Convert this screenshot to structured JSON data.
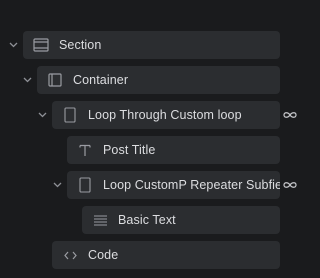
{
  "tree": {
    "section": {
      "label": "Section",
      "icon": "section-icon"
    },
    "container": {
      "label": "Container",
      "icon": "container-icon"
    },
    "loop1": {
      "label": "Loop Through Custom loop",
      "icon": "loop-item-icon",
      "link_icon": "infinity-icon"
    },
    "post_title": {
      "label": "Post Title",
      "icon": "text-icon"
    },
    "loop2": {
      "label": "Loop CustomP Repeater Subfiel",
      "icon": "loop-item-icon",
      "link_icon": "infinity-icon"
    },
    "basic_text": {
      "label": "Basic Text",
      "icon": "text-lines-icon"
    },
    "code": {
      "label": "Code",
      "icon": "code-icon"
    }
  },
  "colors": {
    "background": "#1a1b1d",
    "card": "#2b2d30",
    "text": "#dcdde0",
    "icon": "#8e9096"
  }
}
